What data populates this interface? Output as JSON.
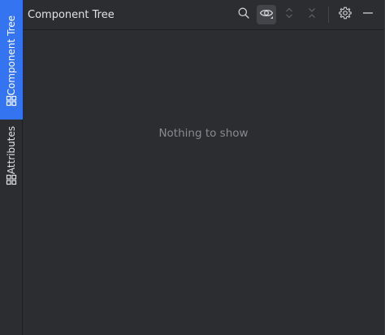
{
  "side_tabs": [
    {
      "label": "Component Tree",
      "icon": "component-tree-icon",
      "active": true
    },
    {
      "label": "Attributes",
      "icon": "attributes-icon",
      "active": false
    }
  ],
  "header": {
    "title": "Component Tree"
  },
  "toolbar": {
    "buttons": [
      "search-icon",
      "eye-icon",
      "expand-icon",
      "collapse-icon",
      "gear-icon",
      "minimize-icon"
    ]
  },
  "content": {
    "empty_text": "Nothing to show"
  },
  "colors": {
    "background": "#2b2d30",
    "accent": "#3574f0",
    "text": "#dfe1e5",
    "muted_text": "#878a91"
  }
}
